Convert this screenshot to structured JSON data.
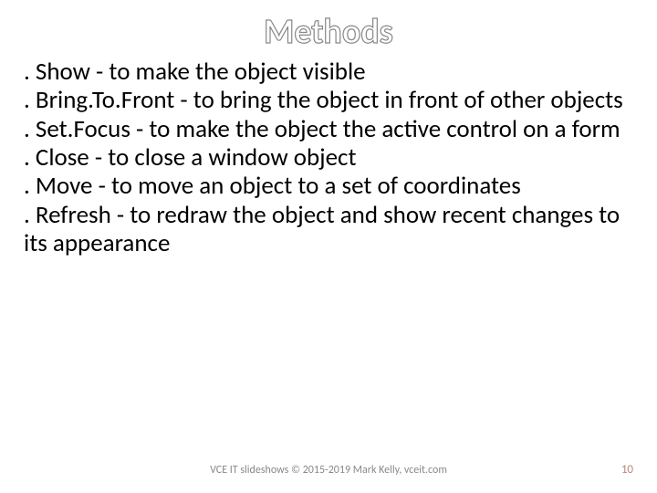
{
  "title": "Methods",
  "body": ". Show - to make the object visible\n. Bring.To.Front - to bring the object in front of other objects\n. Set.Focus - to make the object the active control on a form\n. Close - to close a window object\n. Move - to move an object to a set of coordinates\n. Refresh - to redraw the object and show recent changes to its appearance",
  "footer": "VCE IT slideshows © 2015-2019 Mark Kelly, vceit.com",
  "page_number": "10"
}
